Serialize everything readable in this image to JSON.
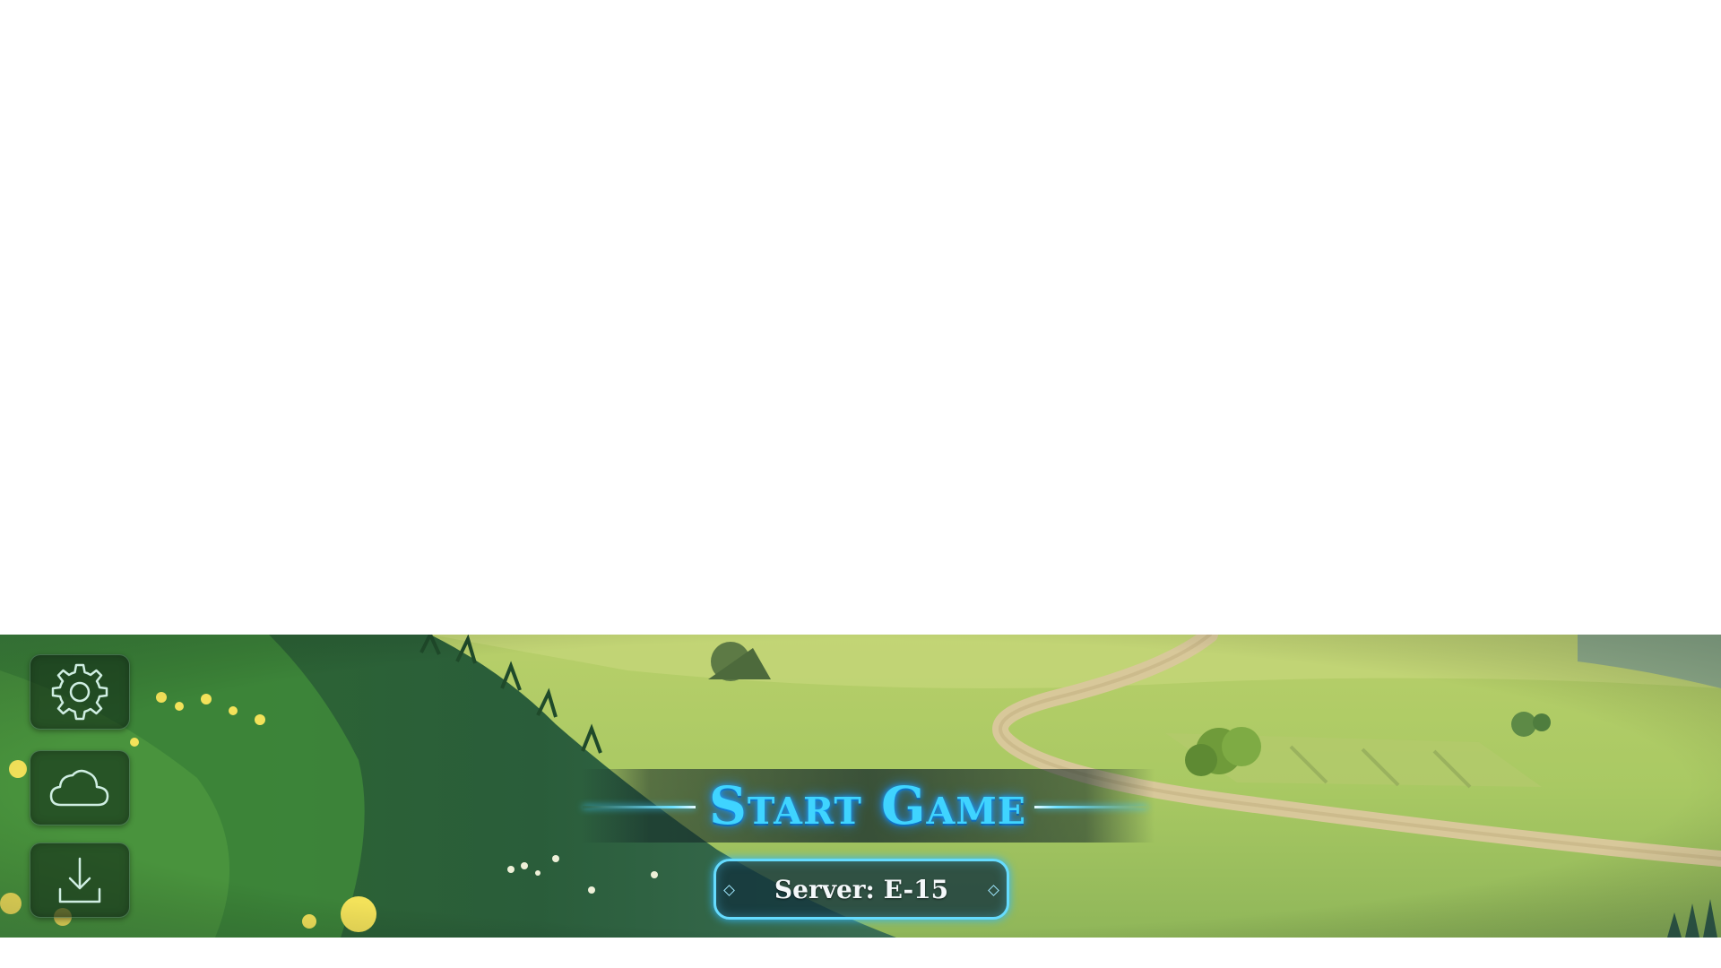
{
  "start_button": {
    "label": "Start Game"
  },
  "server_button": {
    "label": "Server: E-15"
  },
  "side_menu": [
    {
      "icon": "gear-icon"
    },
    {
      "icon": "cloud-icon"
    },
    {
      "icon": "download-icon"
    }
  ],
  "colors": {
    "accent": "#3fd4ff",
    "glow": "#1a8cff",
    "button_bg": "#14321f"
  }
}
